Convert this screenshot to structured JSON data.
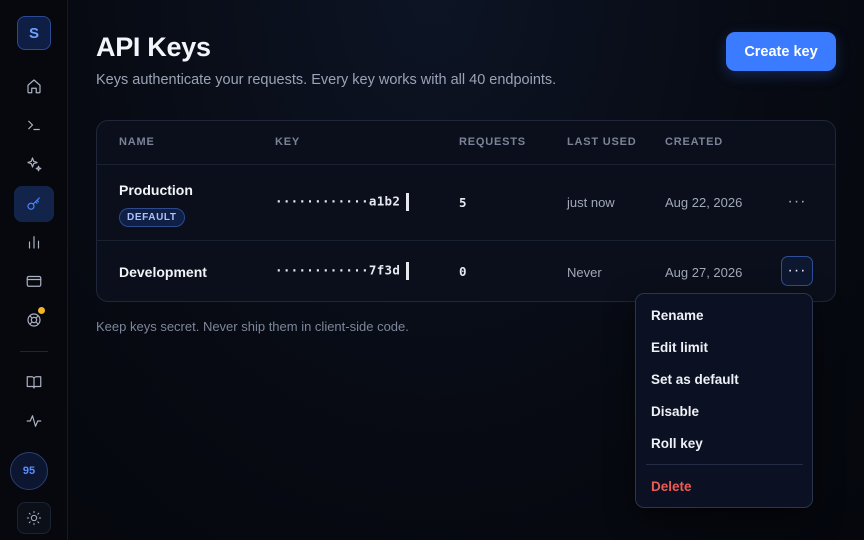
{
  "sidebar": {
    "logo_letter": "S",
    "items": [
      {
        "name": "home-icon"
      },
      {
        "name": "terminal-icon"
      },
      {
        "name": "sparkle-icon"
      },
      {
        "name": "key-icon",
        "active": true
      },
      {
        "name": "bar-chart-icon"
      },
      {
        "name": "credit-card-icon"
      },
      {
        "name": "lifebuoy-icon",
        "notification": true
      },
      {
        "name": "book-icon"
      },
      {
        "name": "activity-icon"
      }
    ],
    "usage_badge": "95",
    "theme_icon": "sun-icon"
  },
  "header": {
    "title": "API Keys",
    "subtitle": "Keys authenticate your requests. Every key works with all 40 endpoints.",
    "create_button": "Create key"
  },
  "table": {
    "columns": [
      "NAME",
      "KEY",
      "REQUESTS",
      "LAST USED",
      "CREATED"
    ],
    "rows": [
      {
        "name": "Production",
        "badge": "DEFAULT",
        "key": "············a1b2",
        "requests": "5",
        "last_used": "just now",
        "created": "Aug 22, 2026"
      },
      {
        "name": "Development",
        "badge": "",
        "key": "············7f3d",
        "requests": "0",
        "last_used": "Never",
        "created": "Aug 27, 2026"
      }
    ],
    "row_action_glyph": "···"
  },
  "footnote": "Keep keys secret. Never ship them in client-side code.",
  "menu": {
    "items": [
      "Rename",
      "Edit limit",
      "Set as default",
      "Disable",
      "Roll key"
    ],
    "danger_item": "Delete"
  },
  "colors": {
    "accent": "#3b7bff",
    "danger": "#ee5b52",
    "notification": "#f5b324"
  }
}
